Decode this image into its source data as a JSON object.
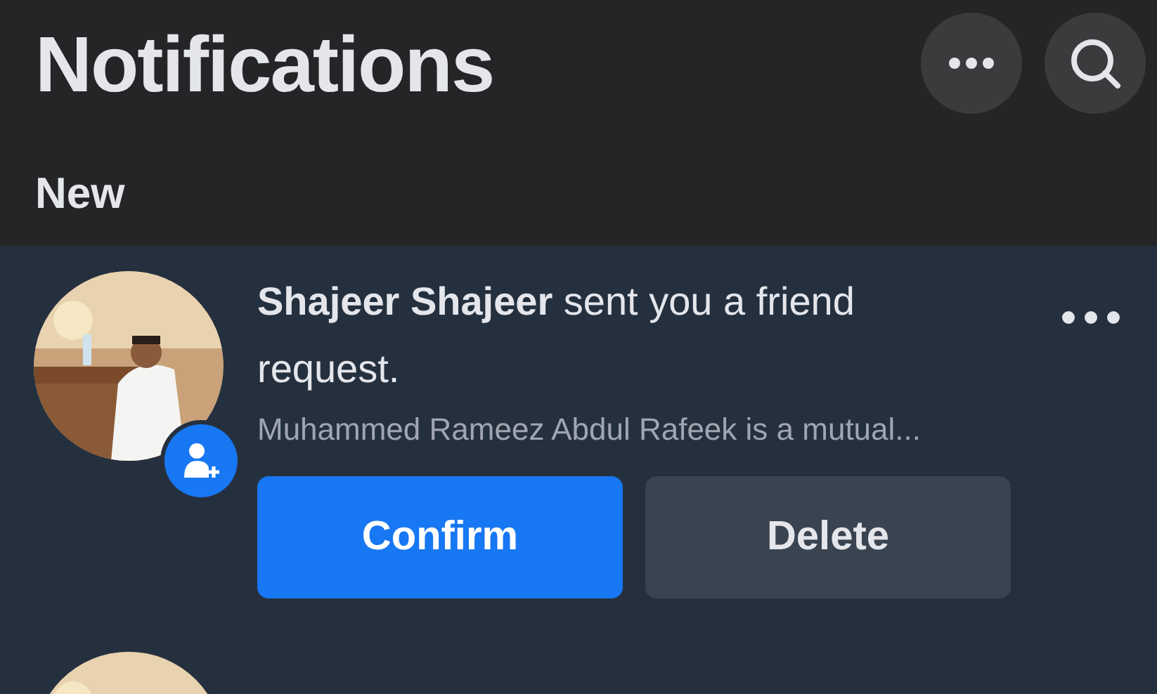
{
  "header": {
    "title": "Notifications",
    "actions": [
      {
        "kind": "more"
      },
      {
        "kind": "search"
      }
    ]
  },
  "section": {
    "label": "New"
  },
  "notifications": [
    {
      "avatar": {
        "kind": "picture"
      },
      "badge": {
        "kind": "add-friend"
      },
      "message": "**Shajeer Shajeer** sent you a friend request.",
      "subtitle": "Muhammed Rameez Abdul Rafeek is a mutual...",
      "buttons": [
        {
          "label": "Confirm",
          "kind": "primary"
        },
        {
          "label": "Delete",
          "kind": "secondary"
        }
      ]
    },
    {
      "avatar": {
        "kind": "picture"
      }
    }
  ]
}
